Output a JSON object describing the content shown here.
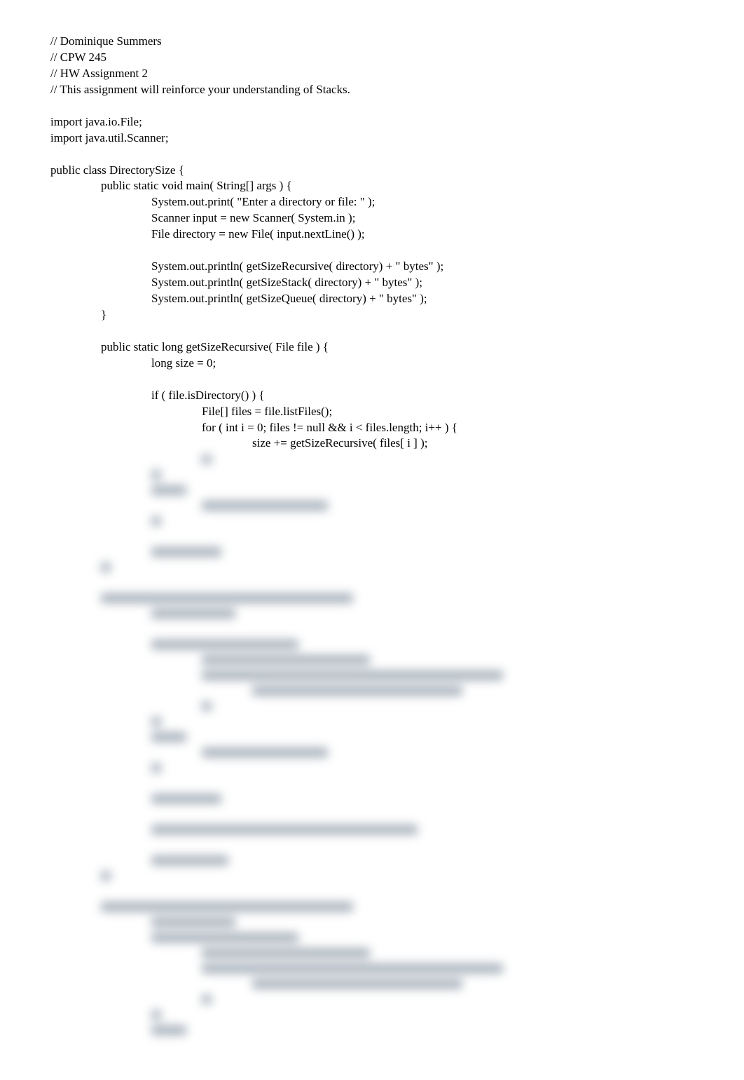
{
  "comments": {
    "c1": "// Dominique Summers",
    "c2": "// CPW 245",
    "c3": "// HW Assignment 2",
    "c4": "// This assignment will reinforce your understanding of Stacks."
  },
  "imports": {
    "i1": "import java.io.File;",
    "i2": "import java.util.Scanner;"
  },
  "class_decl": "public class DirectorySize {",
  "main": {
    "sig": "public static void main( String[] args ) {",
    "l1": "System.out.print( \"Enter a directory or file: \" );",
    "l2": "Scanner input = new Scanner( System.in );",
    "l3": "File directory = new File( input.nextLine() );",
    "l4": "System.out.println( getSizeRecursive( directory) + \" bytes\" );",
    "l5": "System.out.println( getSizeStack( directory) + \" bytes\" );",
    "l6": "System.out.println( getSizeQueue( directory) + \" bytes\" );",
    "close": "}"
  },
  "recursive": {
    "sig": "public static long getSizeRecursive( File file ) {",
    "l1": "long size = 0;",
    "l2": "if ( file.isDirectory() ) {",
    "l3": "File[] files = file.listFiles();",
    "l4": "for ( int i = 0; files != null && i < files.length; i++ ) {",
    "l5": "size += getSizeRecursive( files[ i ] );"
  }
}
